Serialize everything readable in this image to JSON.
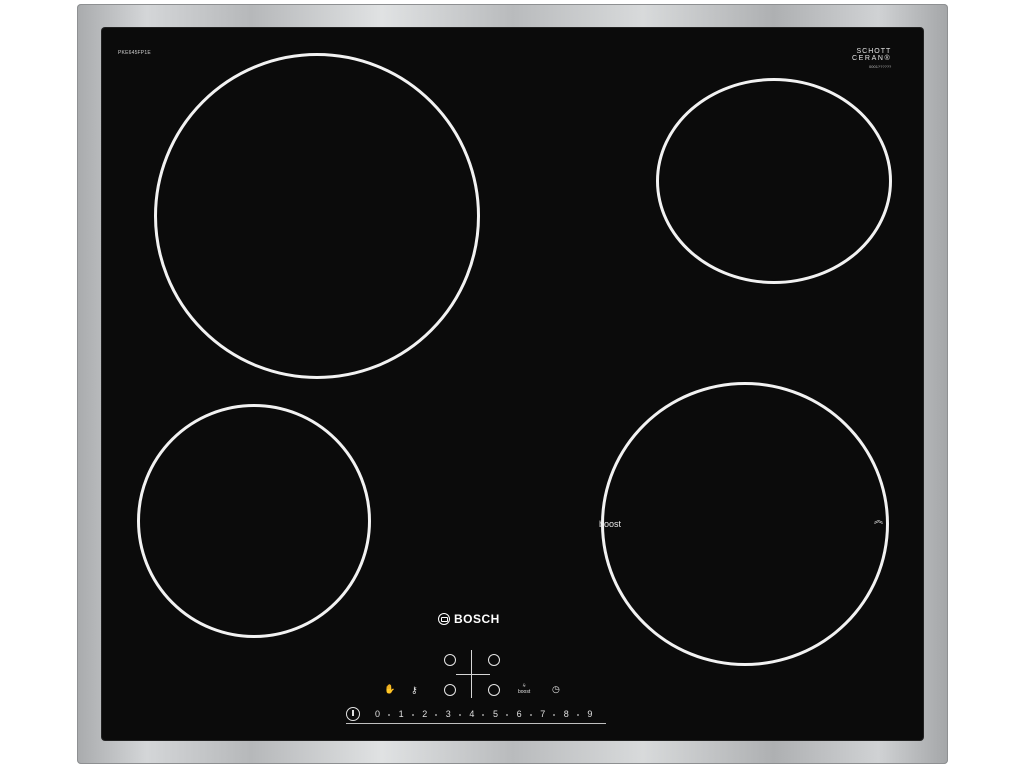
{
  "product": {
    "model_number": "PKE645FP1E",
    "glass_brand": {
      "line1": "SCHOTT",
      "line2": "CERAN®",
      "line3": "0001??????"
    },
    "logo_text": "BOSCH"
  },
  "cooking_zones": [
    {
      "id": "front-left-large"
    },
    {
      "id": "rear-right-small"
    },
    {
      "id": "front-left-small"
    },
    {
      "id": "front-right",
      "boost_label": "boost",
      "extension_marker": "»"
    }
  ],
  "controls": {
    "zone_selectors": 4,
    "icons": [
      "hand-icon",
      "key-icon",
      "boost-icon",
      "timer-icon"
    ],
    "boost_label": "boost",
    "power_scale": [
      "0",
      "1",
      "2",
      "3",
      "4",
      "5",
      "6",
      "7",
      "8",
      "9"
    ]
  },
  "colors": {
    "glass": "#0b0b0b",
    "frame": "#c3c5c7",
    "markings": "#f2f2f2"
  }
}
